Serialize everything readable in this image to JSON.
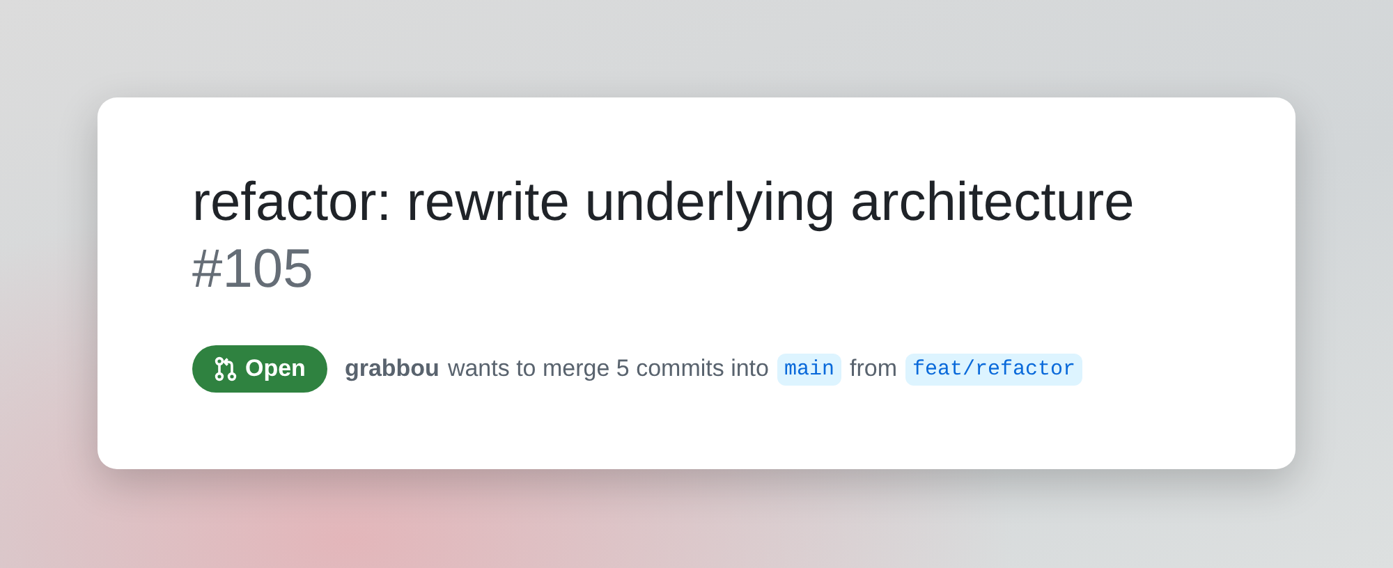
{
  "pull_request": {
    "title": "refactor: rewrite underlying architecture",
    "number": "#105",
    "state": {
      "kind": "open",
      "label": "Open"
    },
    "author": "grabbou",
    "summary": "wants to merge 5 commits into",
    "base_branch": "main",
    "joiner": "from",
    "head_branch": "feat/refactor"
  }
}
